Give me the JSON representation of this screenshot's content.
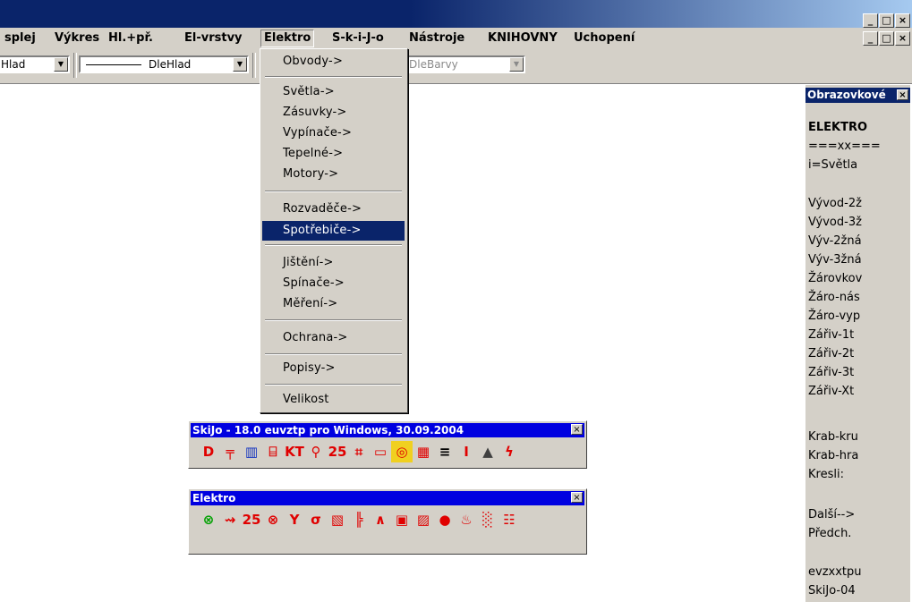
{
  "window": {
    "min": "_",
    "max": "□",
    "close": "×"
  },
  "menubar": {
    "items": [
      "splej",
      "Výkres",
      "Hl.+př.",
      "El-vrstvy",
      "Elektro",
      "S-k-i-J-o",
      "Nástroje",
      "KNIHOVNY",
      "Uchopení"
    ]
  },
  "toolbar": {
    "layer_value": "Hlad",
    "linetype_value": "DleHlad",
    "color_value": "DleBarvy"
  },
  "dropdown": {
    "items": [
      "Obvody->",
      "Světla->",
      "Zásuvky->",
      "Vypínače->",
      "Tepelné->",
      "Motory->",
      "Rozvaděče->",
      "Spotřebiče->",
      "Jištění->",
      "Spínače->",
      "Měření->",
      "Ochrana->",
      "Popisy->",
      "Velikost"
    ],
    "highlighted": "Spotřebiče->"
  },
  "side_panel": {
    "title": "Obrazovkové",
    "lines": [
      "ELEKTRO",
      "===xx===",
      "i=Světla",
      "",
      "Vývod-2ž",
      "Vývod-3ž",
      "Výv-2žná",
      "Výv-3žná",
      "Žárovkov",
      "Žáro-nás",
      "Žáro-vyp",
      "Zářiv-1t",
      "Zářiv-2t",
      "Zářiv-3t",
      "Zářiv-Xt",
      "",
      "Krab-kru",
      "Krab-hra",
      "Kresli:",
      "",
      "Další-->",
      "Předch.",
      "",
      "evzxxtpu",
      "SkiJo-04"
    ]
  },
  "skijo_toolbar": {
    "title": "SkiJo - 18.0 euvztp pro Windows, 30.09.2004",
    "icons": [
      "D",
      "╤",
      "▥",
      "⌸",
      "KT",
      "⚲",
      "25",
      "⌗",
      "▭",
      "◎",
      "▦",
      "≡",
      "I",
      "▲",
      "ϟ"
    ]
  },
  "elektro_toolbar": {
    "title": "Elektro",
    "icons": [
      "⊗",
      "⇝",
      "25",
      "⊗",
      "Y",
      "σ",
      "▧",
      "╠",
      "∧",
      "▣",
      "▨",
      "●",
      "♨",
      "░",
      "☷"
    ]
  },
  "close_glyph": "×"
}
